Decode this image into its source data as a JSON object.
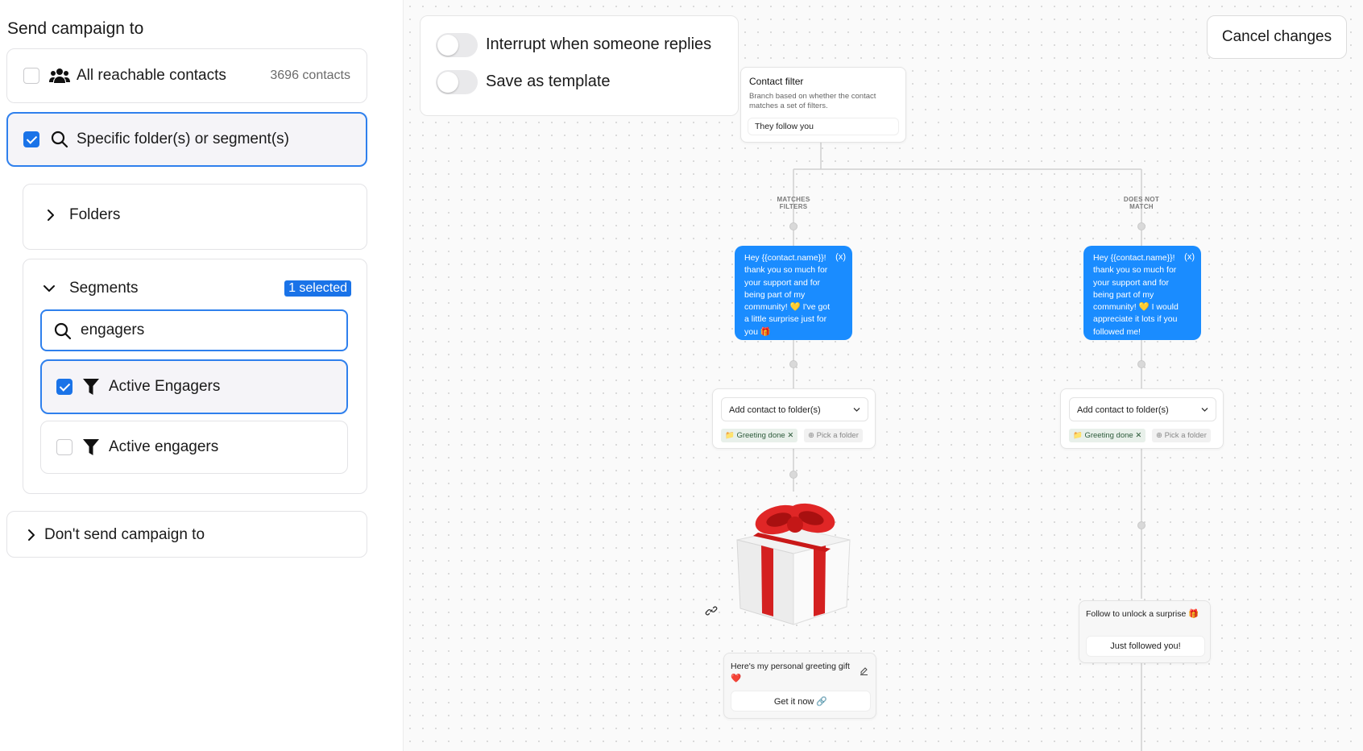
{
  "left_panel": {
    "title": "Send campaign to",
    "all_contacts": {
      "label": "All reachable contacts",
      "count": "3696 contacts",
      "checked": false
    },
    "specific": {
      "label": "Specific folder(s) or segment(s)",
      "checked": true
    },
    "folders": {
      "label": "Folders"
    },
    "segments": {
      "label": "Segments",
      "badge": "1 selected",
      "search_value": "engagers",
      "items": [
        {
          "label": "Active Engagers",
          "checked": true
        },
        {
          "label": "Active engagers",
          "checked": false
        }
      ]
    },
    "dont_send": {
      "label": "Don't send campaign to"
    }
  },
  "options": {
    "interrupt_label": "Interrupt when someone replies",
    "template_label": "Save as template"
  },
  "cancel_label": "Cancel changes",
  "flow": {
    "filter_node": {
      "title": "Contact filter",
      "description": "Branch based on whether the contact matches a set of filters.",
      "condition": "They follow you"
    },
    "left_branch": {
      "caption": "MATCHES FILTERS",
      "message": "Hey {{contact.name}}! thank you so much for your support and for being part of my community! 💛 I've got a little surprise just for you 🎁",
      "var_icon": "(x)",
      "folder_select": "Add contact to folder(s)",
      "folder_tag": "Greeting done",
      "pick_tag": "Pick a folder",
      "greeting_text": "Here's my personal greeting gift ❤️",
      "greeting_button": "Get it now 🔗"
    },
    "right_branch": {
      "caption": "DOES NOT MATCH",
      "message": "Hey {{contact.name}}! thank you so much for your support and for being part of my community! 💛 I would appreciate it lots if you followed me!",
      "var_icon": "(x)",
      "folder_select": "Add contact to folder(s)",
      "folder_tag": "Greeting done",
      "pick_tag": "Pick a folder",
      "unlock_text": "Follow to unlock a surprise 🎁",
      "unlock_button": "Just followed you!"
    }
  },
  "colors": {
    "accent": "#1a73e8",
    "bubble": "#1a8cff",
    "selected_bg": "#f5f4f8"
  }
}
